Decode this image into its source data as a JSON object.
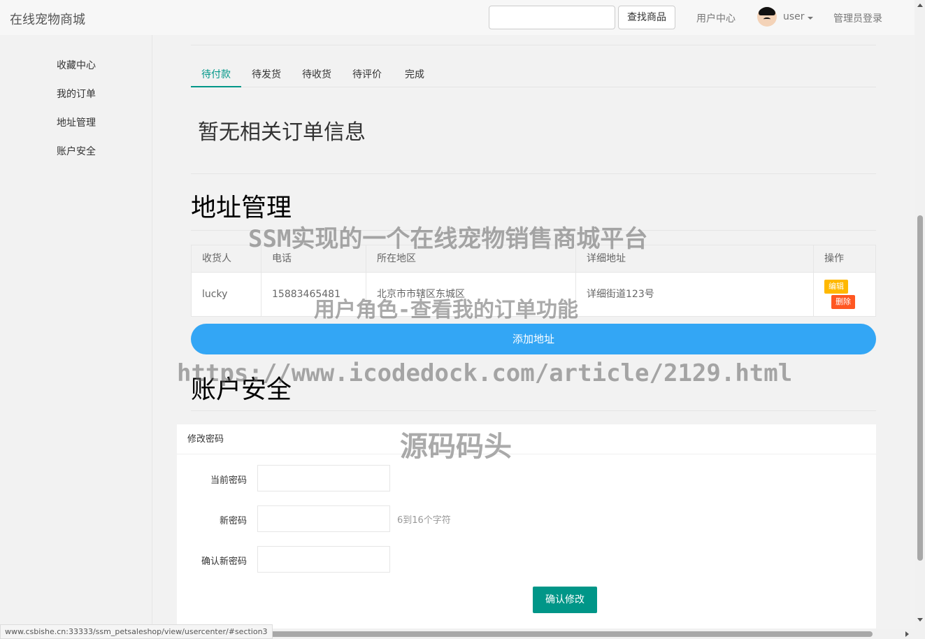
{
  "header": {
    "brand": "在线宠物商城",
    "search_placeholder": "",
    "search_button": "查找商品",
    "user_center": "用户中心",
    "username": "user",
    "admin_login": "管理员登录"
  },
  "sidebar": {
    "items": [
      {
        "label": "收藏中心"
      },
      {
        "label": "我的订单"
      },
      {
        "label": "地址管理"
      },
      {
        "label": "账户安全"
      }
    ]
  },
  "orders": {
    "tabs": [
      {
        "label": "待付款"
      },
      {
        "label": "待发货"
      },
      {
        "label": "待收货"
      },
      {
        "label": "待评价"
      },
      {
        "label": "完成"
      }
    ],
    "empty_message": "暂无相关订单信息"
  },
  "address": {
    "title": "地址管理",
    "columns": [
      "收货人",
      "电话",
      "所在地区",
      "详细地址",
      "操作"
    ],
    "rows": [
      {
        "name": "lucky",
        "phone": "15883465481",
        "region": "北京市市辖区东城区",
        "detail": "详细街道123号",
        "edit": "编辑",
        "delete": "删除"
      }
    ],
    "add_button": "添加地址"
  },
  "security": {
    "title": "账户安全",
    "card_title": "修改密码",
    "fields": [
      {
        "label": "当前密码",
        "value": ""
      },
      {
        "label": "新密码",
        "value": ""
      },
      {
        "label": "确认新密码",
        "value": ""
      }
    ],
    "hint": "6到16个字符",
    "submit": "确认修改"
  },
  "status_url": "www.csbishe.cn:33333/ssm_petsaleshop/view/usercenter/#section3",
  "watermarks": [
    "SSM实现的一个在线宠物销售商城平台",
    "用户角色-查看我的订单功能",
    "https://www.icodedock.com/article/2129.html",
    "源码码头"
  ]
}
